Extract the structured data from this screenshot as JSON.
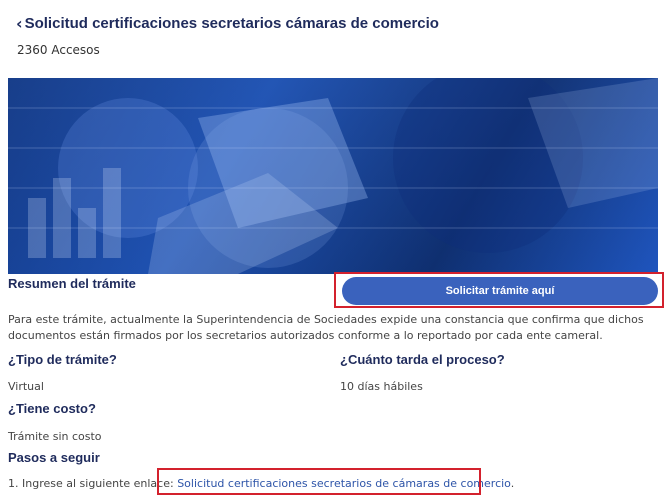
{
  "header": {
    "back_icon": "‹",
    "title": "Solicitud certificaciones secretarios cámaras de comercio"
  },
  "accesses": "2360 Accesos",
  "summary": {
    "title": "Resumen del trámite",
    "cta_label": "Solicitar trámite aquí",
    "description": "Para este trámite, actualmente la Superintendencia de Sociedades expide una constancia que confirma que dichos documentos están firmados por los secretarios autorizados conforme a lo reportado por cada ente cameral."
  },
  "details": {
    "type_label": "¿Tipo de trámite?",
    "type_value": "Virtual",
    "duration_label": "¿Cuánto tarda el proceso?",
    "duration_value": "10 días hábiles",
    "cost_label": "¿Tiene costo?",
    "cost_value": "Trámite sin costo"
  },
  "steps": {
    "title": "Pasos a seguir",
    "step1_prefix": "1. Ingrese al siguiente enlace: ",
    "step1_link": "Solicitud certificaciones secretarios de cámaras de comercio",
    "step1_suffix": "."
  }
}
